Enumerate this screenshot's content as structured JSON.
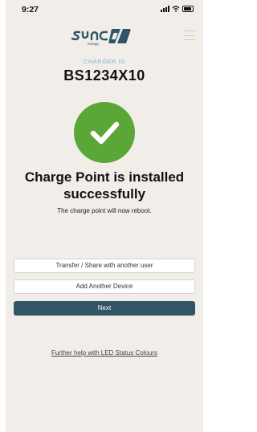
{
  "status_bar": {
    "time": "9:27",
    "icons": [
      "signal-icon",
      "wifi-icon",
      "battery-icon"
    ]
  },
  "header": {
    "logo_text": "sync energy",
    "menu_icon": "hamburger-menu-icon"
  },
  "charger": {
    "label": "CHARGER ID",
    "id": "BS1234X10"
  },
  "success": {
    "icon": "checkmark-icon",
    "title": "Charge Point is installed successfully",
    "subtitle": "The charge point will now reboot."
  },
  "actions": {
    "transfer_label": "Transfer / Share with another user",
    "add_device_label": "Add Another Device",
    "next_label": "Next"
  },
  "help": {
    "link_label": "Further help with LED Status Colours"
  },
  "colors": {
    "background": "#f1eeea",
    "success_green": "#5aa637",
    "primary_button": "#2f5567",
    "label_blue": "#7ab3d6"
  }
}
